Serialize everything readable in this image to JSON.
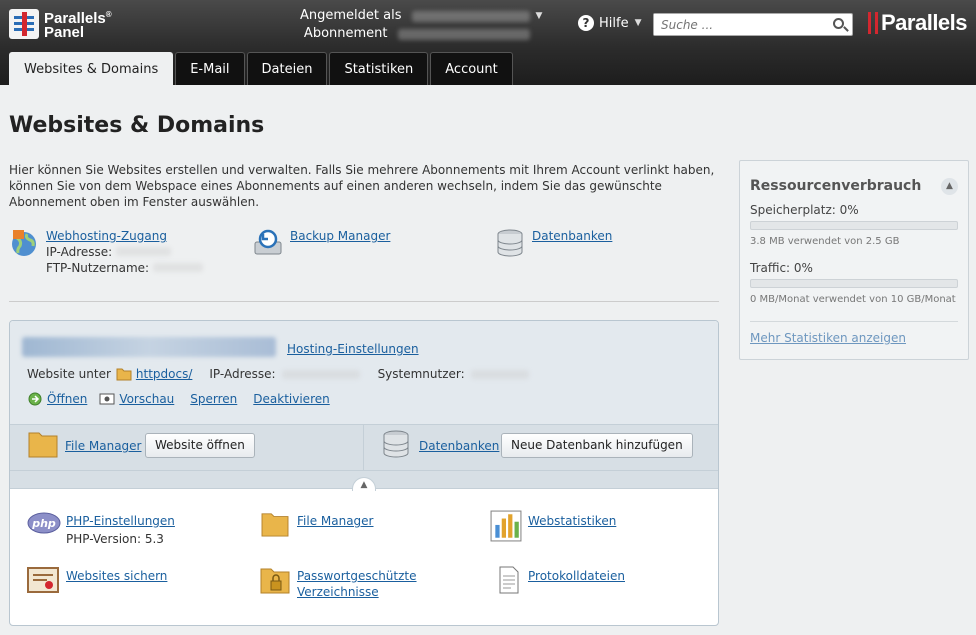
{
  "header": {
    "logo_line1": "Parallels",
    "logo_sup": "®",
    "logo_line2": "Panel",
    "logged_in_label": "Angemeldet als",
    "subscription_label": "Abonnement",
    "help_label": "Hilfe",
    "search_placeholder": "Suche ...",
    "brand": "Parallels"
  },
  "tabs": [
    {
      "label": "Websites & Domains",
      "active": true
    },
    {
      "label": "E-Mail"
    },
    {
      "label": "Dateien"
    },
    {
      "label": "Statistiken"
    },
    {
      "label": "Account"
    }
  ],
  "main": {
    "title": "Websites & Domains",
    "intro": "Hier können Sie Websites erstellen und verwalten. Falls Sie mehrere Abonnements mit Ihrem Account verlinkt haben, können Sie von dem Webspace eines Abonnements auf einen anderen wechseln, indem Sie das gewünschte Abonnement oben im Fenster auswählen.",
    "quick": {
      "webhosting": "Webhosting-Zugang",
      "ip_label": "IP-Adresse:",
      "ftp_label": "FTP-Nutzername:",
      "backup": "Backup Manager",
      "databases": "Datenbanken"
    }
  },
  "subscription": {
    "hosting_settings": "Hosting-Einstellungen",
    "website_at": "Website unter",
    "httpdocs": "httpdocs/",
    "ip_label": "IP-Adresse:",
    "system_user_label": "Systemnutzer:",
    "actions": [
      "Öffnen",
      "Vorschau",
      "Sperren",
      "Deaktivieren"
    ],
    "file_manager": "File Manager",
    "open_website": "Website öffnen",
    "databases": "Datenbanken",
    "add_database": "Neue Datenbank hinzufügen",
    "tools": {
      "php_settings": "PHP-Einstellungen",
      "php_version": "PHP-Version: 5.3",
      "file_manager": "File Manager",
      "web_stats": "Webstatistiken",
      "backup_sites": "Websites sichern",
      "protected_dirs_1": "Passwortgeschützte",
      "protected_dirs_2": "Verzeichnisse",
      "logs": "Protokolldateien"
    }
  },
  "resources": {
    "title": "Ressourcenverbrauch",
    "storage_label": "Speicherplatz: 0%",
    "storage_pct": 0,
    "storage_detail": "3.8 MB verwendet von 2.5 GB",
    "traffic_label": "Traffic: 0%",
    "traffic_pct": 0,
    "traffic_detail": "0 MB/Monat verwendet von 10 GB/Monat",
    "more_stats": "Mehr Statistiken anzeigen"
  },
  "colors": {
    "link": "#1a5f9e",
    "header_bg": "#2c2c2c",
    "brand_red": "#d3272f"
  }
}
